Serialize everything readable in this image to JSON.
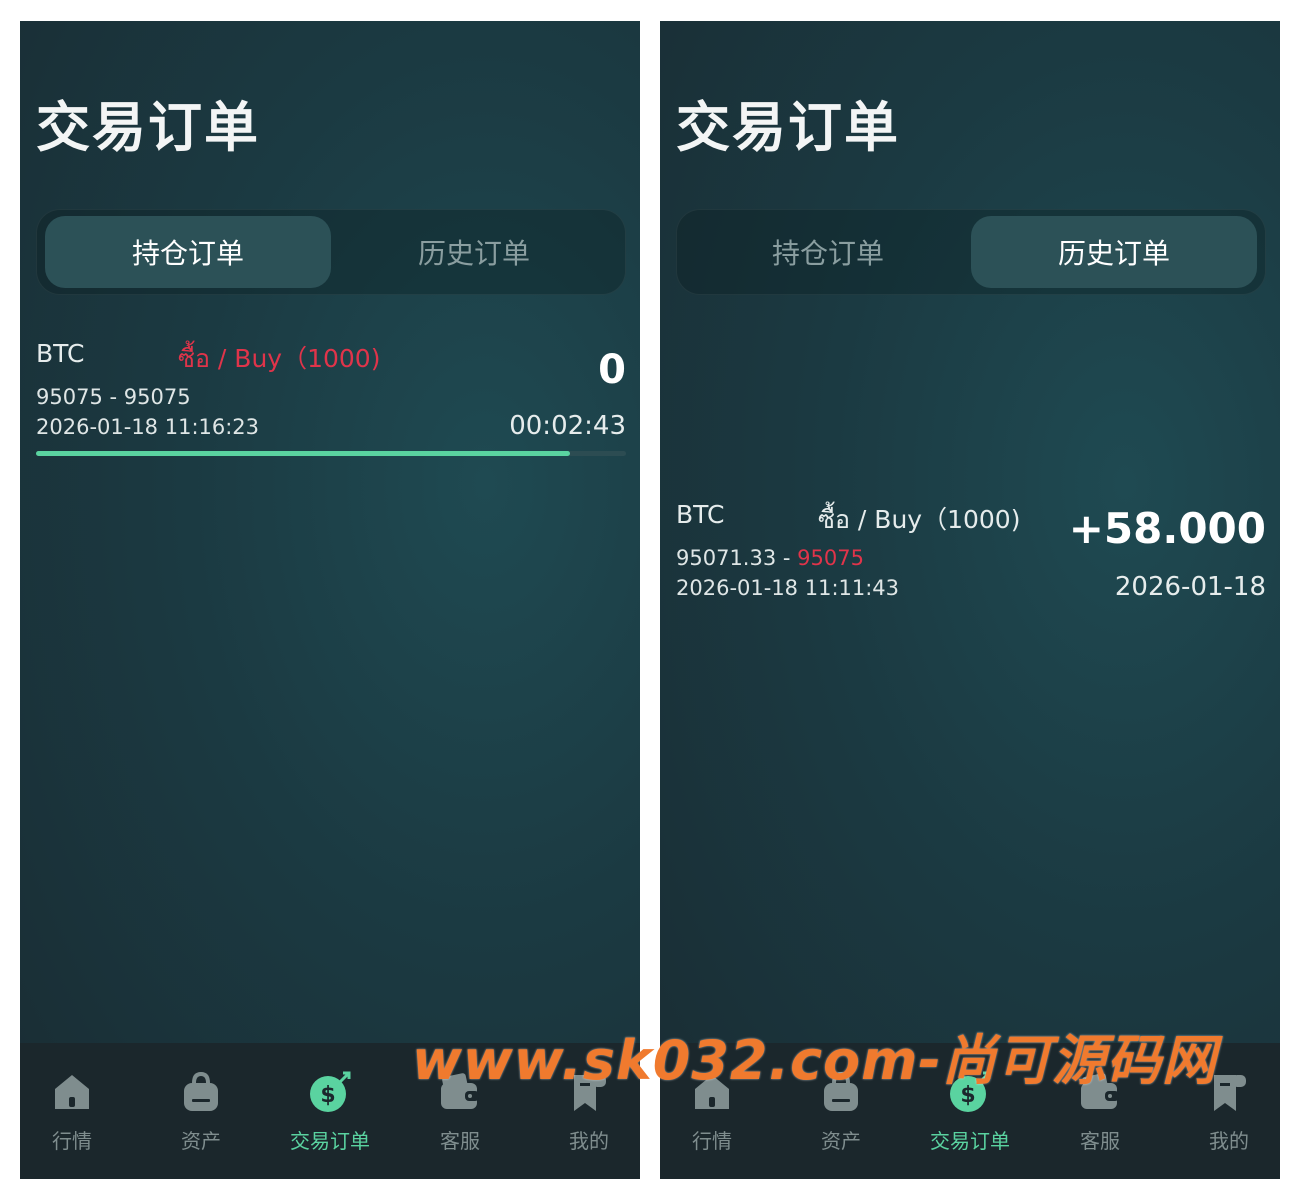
{
  "panels": [
    {
      "title": "交易订单",
      "tabs": [
        {
          "label": "持仓订单",
          "active": true
        },
        {
          "label": "历史订单",
          "active": false
        }
      ],
      "order": {
        "symbol": "BTC",
        "direction": "ซื้อ / Buy（1000)",
        "price_open": "95075",
        "price_sep": " - ",
        "price_close": "95075",
        "time": "2026-01-18 11:16:23",
        "value": "0",
        "right_sub": "00:02:43",
        "progress": 0.905
      }
    },
    {
      "title": "交易订单",
      "tabs": [
        {
          "label": "持仓订单",
          "active": false
        },
        {
          "label": "历史订单",
          "active": true
        }
      ],
      "order": {
        "symbol": "BTC",
        "direction": "ซื้อ / Buy（1000)",
        "price_open": "95071.33",
        "price_sep": " - ",
        "price_close": "95075",
        "time": "2026-01-18 11:11:43",
        "value": "+58.000",
        "right_sub": "2026-01-18"
      }
    }
  ],
  "nav": [
    {
      "label": "行情",
      "icon": "home-icon"
    },
    {
      "label": "资产",
      "icon": "bag-icon"
    },
    {
      "label": "交易订单",
      "icon": "dollar-coin-icon",
      "active": true
    },
    {
      "label": "客服",
      "icon": "wallet-icon"
    },
    {
      "label": "我的",
      "icon": "receipt-icon"
    }
  ],
  "colors": {
    "accent": "#5ad3a0",
    "sell_red": "#e0344a",
    "tab_active": "#2c5157",
    "nav_bg": "#1b272c"
  },
  "watermark": "www.sk032.com-尚可源码网"
}
